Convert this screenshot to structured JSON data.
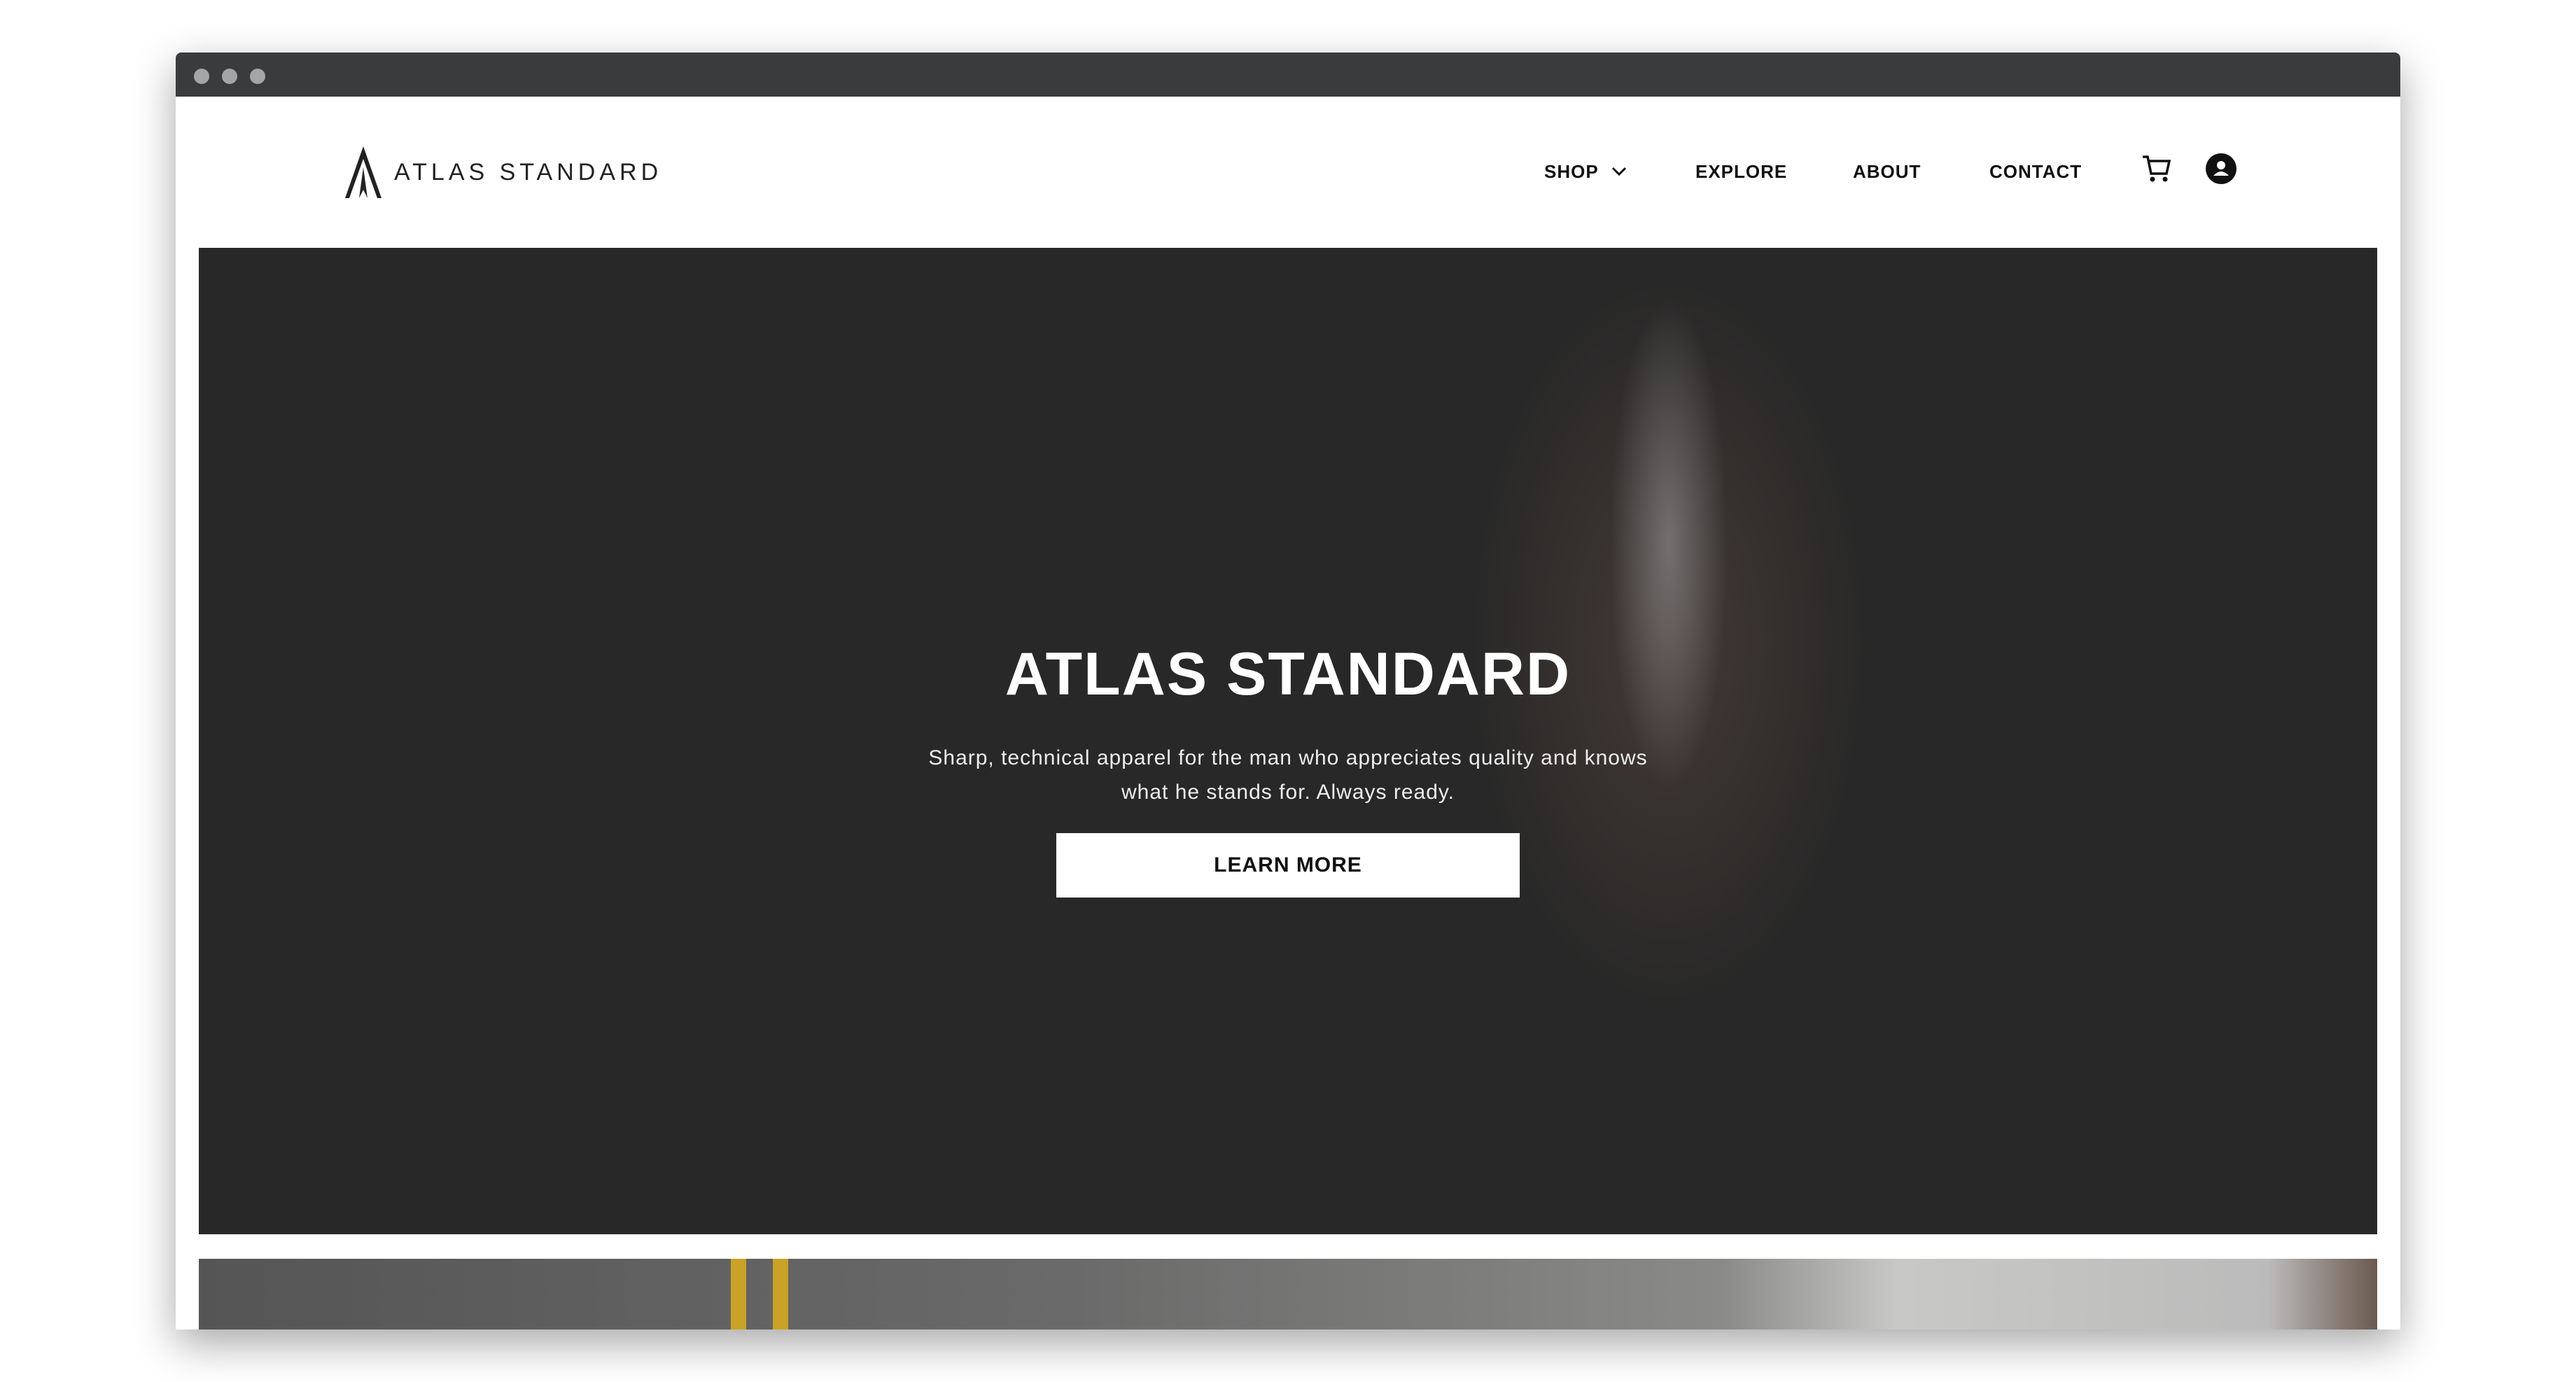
{
  "brand": {
    "name": "ATLAS STANDARD"
  },
  "nav": {
    "items": [
      {
        "label": "SHOP"
      },
      {
        "label": "EXPLORE"
      },
      {
        "label": "ABOUT"
      },
      {
        "label": "CONTACT"
      }
    ]
  },
  "hero": {
    "title": "ATLAS STANDARD",
    "subtitle_line1": "Sharp, technical apparel for the man who appreciates quality and knows",
    "subtitle_line2": "what he stands for. Always ready.",
    "cta": "LEARN MORE"
  }
}
